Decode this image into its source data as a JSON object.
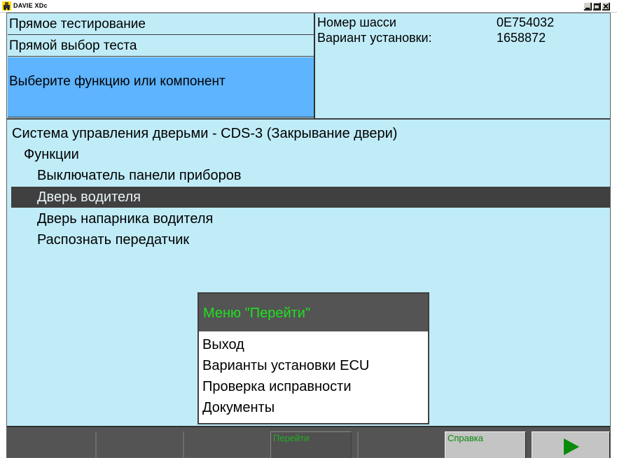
{
  "window": {
    "title": "DAVIE XDc",
    "icon": "davie-app-icon"
  },
  "header": {
    "title": "Прямое тестирование",
    "mode": "Прямой выбор теста",
    "prompt": "Выберите функцию или компонент",
    "chassis_label": "Номер шасси",
    "chassis_value": "0E754032",
    "install_label": "Вариант установки:",
    "install_value": "1658872"
  },
  "tree": {
    "root": "Система управления дверьми - CDS-3 (Закрывание двери)",
    "group": "Функции",
    "items": [
      "Выключатель панели приборов",
      "Дверь водителя",
      "Дверь напарника водителя",
      "Распознать передатчик"
    ],
    "selected_index": 1
  },
  "go_menu": {
    "title": "Меню \"Перейти\"",
    "items": [
      "Выход",
      "Варианты установки ECU",
      "Проверка исправности",
      "Документы"
    ]
  },
  "function_bar": {
    "go_label": "Перейти",
    "help_label": "Справка",
    "next_icon": "play-arrow-icon"
  },
  "colors": {
    "panel_bg": "#c0ecf8",
    "prompt_bg": "#5eb4ff",
    "selection_bg": "#404040",
    "menu_title_fg": "#20e020",
    "bar_bg": "#545454"
  }
}
